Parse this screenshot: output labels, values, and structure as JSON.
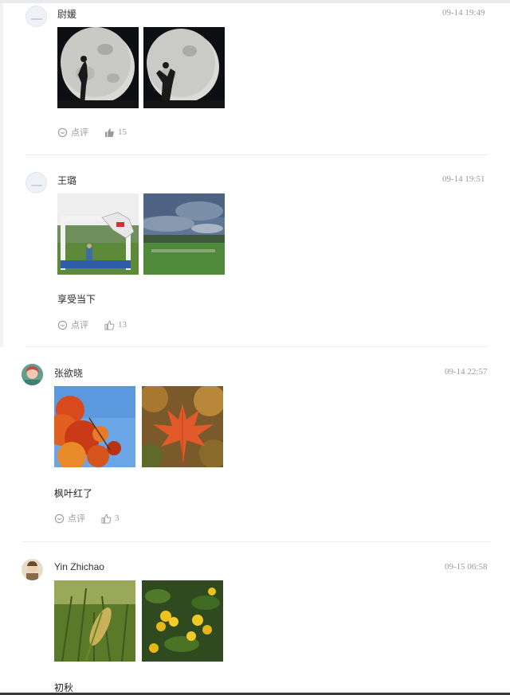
{
  "comment_label": "点评",
  "posts": [
    {
      "name": "尉媛",
      "time": "09-14 19:49",
      "caption": "",
      "likes": "15"
    },
    {
      "name": "王璐",
      "time": "09-14 19:51",
      "caption": "享受当下",
      "likes": "13"
    },
    {
      "name": "张欲晓",
      "time": "09-14 22:57",
      "caption": "枫叶红了",
      "likes": "3"
    },
    {
      "name": "Yin Zhichao",
      "time": "09-15 06:58",
      "caption": "初秋",
      "likes": ""
    }
  ],
  "icons": {
    "comment": "comment-icon",
    "like": "thumbs-up-icon"
  },
  "colors": {
    "text": "#333333",
    "muted": "#9a9a9a",
    "divider": "#ececec"
  }
}
